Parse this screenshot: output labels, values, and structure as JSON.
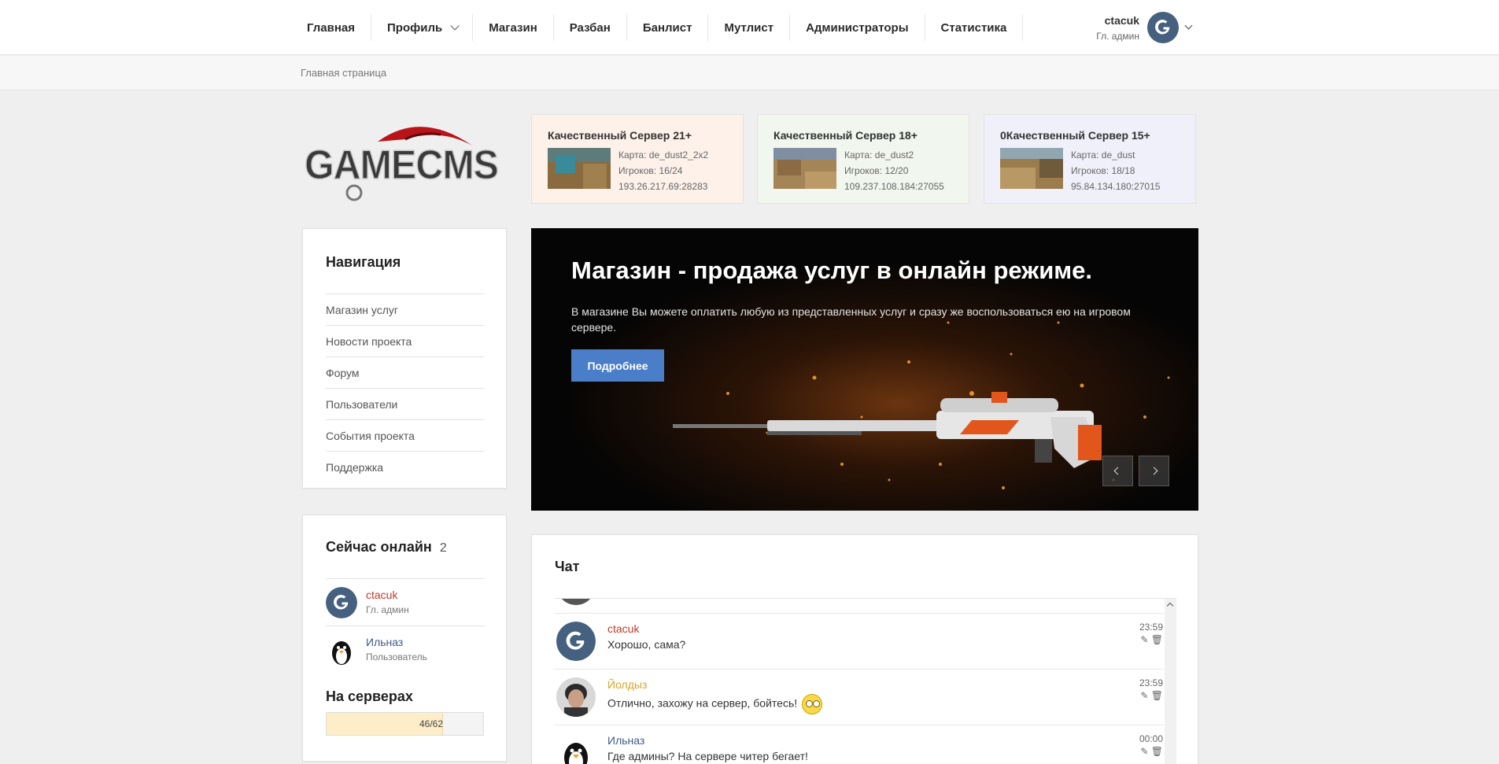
{
  "nav": {
    "items": [
      {
        "label": "Главная"
      },
      {
        "label": "Профиль"
      },
      {
        "label": "Магазин"
      },
      {
        "label": "Разбан"
      },
      {
        "label": "Банлист"
      },
      {
        "label": "Мутлист"
      },
      {
        "label": "Администраторы"
      },
      {
        "label": "Статистика"
      }
    ]
  },
  "user": {
    "name": "ctacuk",
    "role": "Гл. админ",
    "avatar_icon": "google-g-icon"
  },
  "breadcrumb": {
    "current": "Главная страница"
  },
  "logo": {
    "text": "GAMECMS"
  },
  "servers": [
    {
      "title": "Качественный Сервер 21+",
      "map": "Карта: de_dust2_2x2",
      "players": "Игроков: 16/24",
      "address": "193.26.217.69:28283",
      "bg": "#fdf1ea"
    },
    {
      "title": "Качественный Сервер 18+",
      "map": "Карта: de_dust2",
      "players": "Игроков: 12/20",
      "address": "109.237.108.184:27055",
      "bg": "#f1f6ee"
    },
    {
      "title": "0Качественный Сервер 15+",
      "map": "Карта: de_dust",
      "players": "Игроков: 18/18",
      "address": "95.84.134.180:27015",
      "bg": "#f0f0fb"
    }
  ],
  "navigation": {
    "title": "Навигация",
    "items": [
      {
        "label": "Магазин услуг"
      },
      {
        "label": "Новости проекта"
      },
      {
        "label": "Форум"
      },
      {
        "label": "Пользователи"
      },
      {
        "label": "События проекта"
      },
      {
        "label": "Поддержка"
      }
    ]
  },
  "online": {
    "title": "Сейчас онлайн",
    "count": "2",
    "users": [
      {
        "name": "ctacuk",
        "role": "Гл. админ",
        "color": "#c0392b"
      },
      {
        "name": "Ильназ",
        "role": "Пользователь",
        "color": "#3e5a86"
      }
    ],
    "servers_title": "На серверах",
    "servers_fill": "46/62",
    "servers_fraction": 0.742
  },
  "banner": {
    "title": "Магазин - продажа услуг в онлайн режиме.",
    "text": "В магазине Вы можете оплатить любую из представленных услуг и сразу же воспользоваться ею на игровом сервере.",
    "button": "Подробнее"
  },
  "chat": {
    "title": "Чат",
    "messages": [
      {
        "name": "ctacuk",
        "text": "Хорошо, сама?",
        "time": "23:59",
        "color": "#c0392b"
      },
      {
        "name": "Йолдыз",
        "text": "Отлично, захожу на сервер, бойтесь!",
        "time": "23:59",
        "color": "#d4a62a"
      },
      {
        "name": "Ильназ",
        "text": "Где админы? На сервере читер бегает!",
        "time": "00:00",
        "color": "#3e5a86"
      }
    ]
  }
}
